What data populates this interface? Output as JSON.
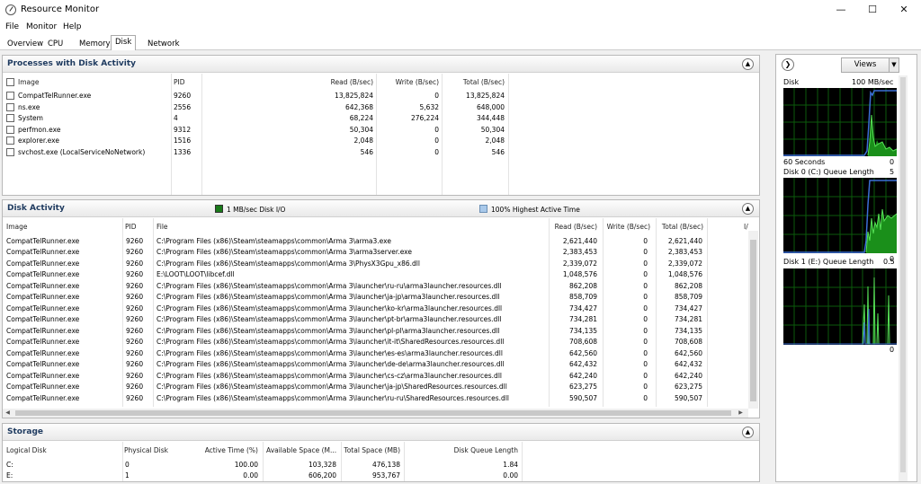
{
  "window": {
    "title": "Resource Monitor",
    "minimize_icon": "minimize-icon",
    "maximize_icon": "maximize-icon",
    "close_icon": "close-icon"
  },
  "menu": [
    "File",
    "Monitor",
    "Help"
  ],
  "tabs": [
    {
      "label": "Overview",
      "active": false
    },
    {
      "label": "CPU",
      "active": false
    },
    {
      "label": "Memory",
      "active": false
    },
    {
      "label": "Disk",
      "active": true
    },
    {
      "label": "Network",
      "active": false
    }
  ],
  "processes": {
    "title": "Processes with Disk Activity",
    "columns": {
      "image": "Image",
      "pid": "PID",
      "read": "Read (B/sec)",
      "write": "Write (B/sec)",
      "total": "Total (B/sec)"
    },
    "rows": [
      {
        "image": "CompatTelRunner.exe",
        "pid": "9260",
        "read": "13,825,824",
        "write": "0",
        "total": "13,825,824"
      },
      {
        "image": "ns.exe",
        "pid": "2556",
        "read": "642,368",
        "write": "5,632",
        "total": "648,000"
      },
      {
        "image": "System",
        "pid": "4",
        "read": "68,224",
        "write": "276,224",
        "total": "344,448"
      },
      {
        "image": "perfmon.exe",
        "pid": "9312",
        "read": "50,304",
        "write": "0",
        "total": "50,304"
      },
      {
        "image": "explorer.exe",
        "pid": "1516",
        "read": "2,048",
        "write": "0",
        "total": "2,048"
      },
      {
        "image": "svchost.exe (LocalServiceNoNetwork)",
        "pid": "1336",
        "read": "546",
        "write": "0",
        "total": "546"
      }
    ]
  },
  "disk_activity": {
    "title": "Disk Activity",
    "legend_io": "1 MB/sec Disk I/O",
    "legend_active": "100% Highest Active Time",
    "legend_io_color": "#1a7a1a",
    "legend_active_color": "#a9c9ea",
    "columns": {
      "image": "Image",
      "pid": "PID",
      "file": "File",
      "read": "Read (B/sec)",
      "write": "Write (B/sec)",
      "total": "Total (B/sec)",
      "extra": "I/"
    },
    "rows": [
      {
        "image": "CompatTelRunner.exe",
        "pid": "9260",
        "file": "C:\\Program Files (x86)\\Steam\\steamapps\\common\\Arma 3\\arma3.exe",
        "read": "2,621,440",
        "write": "0",
        "total": "2,621,440"
      },
      {
        "image": "CompatTelRunner.exe",
        "pid": "9260",
        "file": "C:\\Program Files (x86)\\Steam\\steamapps\\common\\Arma 3\\arma3server.exe",
        "read": "2,383,453",
        "write": "0",
        "total": "2,383,453"
      },
      {
        "image": "CompatTelRunner.exe",
        "pid": "9260",
        "file": "C:\\Program Files (x86)\\Steam\\steamapps\\common\\Arma 3\\PhysX3Gpu_x86.dll",
        "read": "2,339,072",
        "write": "0",
        "total": "2,339,072"
      },
      {
        "image": "CompatTelRunner.exe",
        "pid": "9260",
        "file": "E:\\LOOT\\LOOT\\libcef.dll",
        "read": "1,048,576",
        "write": "0",
        "total": "1,048,576"
      },
      {
        "image": "CompatTelRunner.exe",
        "pid": "9260",
        "file": "C:\\Program Files (x86)\\Steam\\steamapps\\common\\Arma 3\\launcher\\ru-ru\\arma3launcher.resources.dll",
        "read": "862,208",
        "write": "0",
        "total": "862,208"
      },
      {
        "image": "CompatTelRunner.exe",
        "pid": "9260",
        "file": "C:\\Program Files (x86)\\Steam\\steamapps\\common\\Arma 3\\launcher\\ja-jp\\arma3launcher.resources.dll",
        "read": "858,709",
        "write": "0",
        "total": "858,709"
      },
      {
        "image": "CompatTelRunner.exe",
        "pid": "9260",
        "file": "C:\\Program Files (x86)\\Steam\\steamapps\\common\\Arma 3\\launcher\\ko-kr\\arma3launcher.resources.dll",
        "read": "734,427",
        "write": "0",
        "total": "734,427"
      },
      {
        "image": "CompatTelRunner.exe",
        "pid": "9260",
        "file": "C:\\Program Files (x86)\\Steam\\steamapps\\common\\Arma 3\\launcher\\pt-br\\arma3launcher.resources.dll",
        "read": "734,281",
        "write": "0",
        "total": "734,281"
      },
      {
        "image": "CompatTelRunner.exe",
        "pid": "9260",
        "file": "C:\\Program Files (x86)\\Steam\\steamapps\\common\\Arma 3\\launcher\\pl-pl\\arma3launcher.resources.dll",
        "read": "734,135",
        "write": "0",
        "total": "734,135"
      },
      {
        "image": "CompatTelRunner.exe",
        "pid": "9260",
        "file": "C:\\Program Files (x86)\\Steam\\steamapps\\common\\Arma 3\\launcher\\it-it\\SharedResources.resources.dll",
        "read": "708,608",
        "write": "0",
        "total": "708,608"
      },
      {
        "image": "CompatTelRunner.exe",
        "pid": "9260",
        "file": "C:\\Program Files (x86)\\Steam\\steamapps\\common\\Arma 3\\launcher\\es-es\\arma3launcher.resources.dll",
        "read": "642,560",
        "write": "0",
        "total": "642,560"
      },
      {
        "image": "CompatTelRunner.exe",
        "pid": "9260",
        "file": "C:\\Program Files (x86)\\Steam\\steamapps\\common\\Arma 3\\launcher\\de-de\\arma3launcher.resources.dll",
        "read": "642,432",
        "write": "0",
        "total": "642,432"
      },
      {
        "image": "CompatTelRunner.exe",
        "pid": "9260",
        "file": "C:\\Program Files (x86)\\Steam\\steamapps\\common\\Arma 3\\launcher\\cs-cz\\arma3launcher.resources.dll",
        "read": "642,240",
        "write": "0",
        "total": "642,240"
      },
      {
        "image": "CompatTelRunner.exe",
        "pid": "9260",
        "file": "C:\\Program Files (x86)\\Steam\\steamapps\\common\\Arma 3\\launcher\\ja-jp\\SharedResources.resources.dll",
        "read": "623,275",
        "write": "0",
        "total": "623,275"
      },
      {
        "image": "CompatTelRunner.exe",
        "pid": "9260",
        "file": "C:\\Program Files (x86)\\Steam\\steamapps\\common\\Arma 3\\launcher\\ru-ru\\SharedResources.resources.dll",
        "read": "590,507",
        "write": "0",
        "total": "590,507"
      }
    ]
  },
  "storage": {
    "title": "Storage",
    "columns": {
      "logical": "Logical Disk",
      "physical": "Physical Disk",
      "active": "Active Time (%)",
      "available": "Available Space (M...",
      "total": "Total Space (MB)",
      "queue": "Disk Queue Length"
    },
    "rows": [
      {
        "logical": "C:",
        "physical": "0",
        "active": "100.00",
        "available": "103,328",
        "total": "476,138",
        "queue": "1.84"
      },
      {
        "logical": "E:",
        "physical": "1",
        "active": "0.00",
        "available": "606,200",
        "total": "953,767",
        "queue": "0.00"
      }
    ]
  },
  "side": {
    "views_label": "Views",
    "graphs": [
      {
        "name": "Disk",
        "max": "100 MB/sec",
        "bottom_left": "60 Seconds",
        "min": "0"
      },
      {
        "name": "Disk 0 (C:) Queue Length",
        "max": "5",
        "bottom_left": "",
        "min": "0"
      },
      {
        "name": "Disk 1 (E:) Queue Length",
        "max": "0.5",
        "bottom_left": "",
        "min": "0"
      }
    ]
  }
}
